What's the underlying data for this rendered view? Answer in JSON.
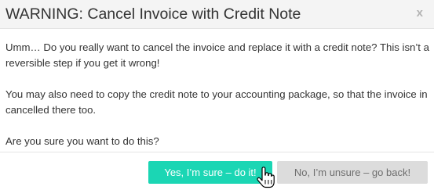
{
  "dialog": {
    "title": "WARNING: Cancel Invoice with Credit Note",
    "close_label": "x",
    "paragraphs": [
      "Umm… Do you really want to cancel the invoice and replace it with a credit note? This isn’t a reversible step if you get it wrong!",
      "You may also need to copy the credit note to your accounting package, so that the invoice in cancelled there too.",
      "Are you sure you want to do this?"
    ],
    "confirm_label": "Yes, I’m sure – do it!",
    "cancel_label": "No, I’m unsure – go back!"
  },
  "colors": {
    "confirm_bg": "#1bd6b4",
    "cancel_bg": "#dcdcdc",
    "header_bg": "#f4f4f4"
  },
  "icons": {
    "cursor": "hand-pointer-icon"
  }
}
